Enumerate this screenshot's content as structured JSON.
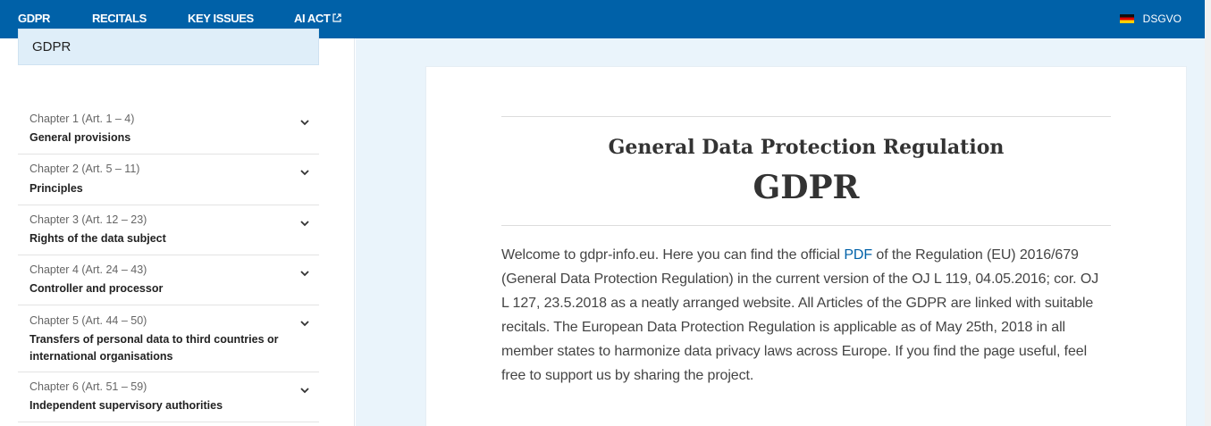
{
  "nav": {
    "items": [
      {
        "label": "GDPR",
        "active": true
      },
      {
        "label": "RECITALS"
      },
      {
        "label": "KEY ISSUES"
      },
      {
        "label": "AI ACT",
        "icon": "external-link-icon"
      }
    ],
    "language": {
      "label": "DSGVO",
      "icon": "german-flag-icon"
    },
    "color": "#0061a8"
  },
  "sidebar": {
    "heading": "GDPR",
    "chapters": [
      {
        "label": "Chapter 1 (Art. 1 – 4)",
        "title": "General provisions"
      },
      {
        "label": "Chapter 2 (Art. 5 – 11)",
        "title": "Principles"
      },
      {
        "label": "Chapter 3 (Art. 12 – 23)",
        "title": "Rights of the data subject"
      },
      {
        "label": "Chapter 4 (Art. 24 – 43)",
        "title": "Controller and processor"
      },
      {
        "label": "Chapter 5 (Art. 44 – 50)",
        "title": "Transfers of personal data to third countries or international organisations"
      },
      {
        "label": "Chapter 6 (Art. 51 – 59)",
        "title": "Independent supervisory authorities"
      }
    ]
  },
  "main": {
    "subtitle": "General Data Protection Regulation",
    "title": "GDPR",
    "intro_before": "Welcome to gdpr-info.eu. Here you can find the official ",
    "intro_link": "PDF",
    "intro_after": " of the Regulation (EU) 2016/679 (General Data Protection Regulation) in the current version of the OJ L 119, 04.05.2016; cor. OJ L 127, 23.5.2018 as a neatly arranged website. All Articles of the GDPR are linked with suitable recitals. The European Data Protection Regulation is applicable as of May 25th, 2018 in all member states to harmonize data privacy laws across Europe. If you find the page useful, feel free to support us by sharing the project."
  }
}
